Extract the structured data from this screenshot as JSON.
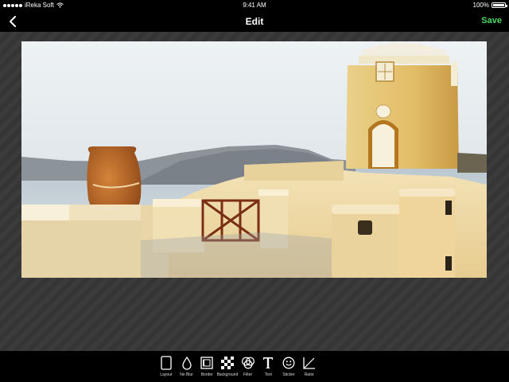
{
  "status": {
    "carrier": "iReka Soft",
    "time": "9:41 AM",
    "battery": "100%"
  },
  "nav": {
    "title": "Edit",
    "save_label": "Save",
    "save_color": "#4cd964"
  },
  "photo": {
    "description_icon": "santorini-photo"
  },
  "toolbar": {
    "tools": [
      {
        "label": "Layout",
        "icon": "layout-icon"
      },
      {
        "label": "No Blur",
        "icon": "drop-icon"
      },
      {
        "label": "Border",
        "icon": "border-icon"
      },
      {
        "label": "Background",
        "icon": "checker-icon"
      },
      {
        "label": "Filter",
        "icon": "filter-icon"
      },
      {
        "label": "Text",
        "icon": "text-icon"
      },
      {
        "label": "Sticker",
        "icon": "smiley-icon"
      },
      {
        "label": "Ratio",
        "icon": "ratio-icon"
      }
    ]
  }
}
